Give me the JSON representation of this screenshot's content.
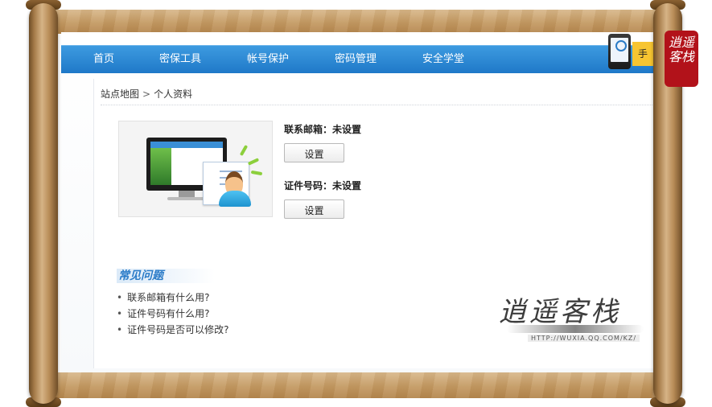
{
  "nav": {
    "items": [
      {
        "label": "首页"
      },
      {
        "label": "密保工具"
      },
      {
        "label": "帐号保护"
      },
      {
        "label": "密码管理"
      },
      {
        "label": "安全学堂"
      }
    ],
    "side_tag": "手"
  },
  "breadcrumb": {
    "root": "站点地图",
    "separator": ">",
    "current": "个人资料"
  },
  "profile": {
    "email_label": "联系邮箱：未设置",
    "email_button": "设置",
    "id_label": "证件号码：未设置",
    "id_button": "设置"
  },
  "faq": {
    "title": "常见问题",
    "items": [
      "联系邮箱有什么用?",
      "证件号码有什么用?",
      "证件号码是否可以修改?"
    ]
  },
  "watermark": {
    "title": "逍遥客栈",
    "url": "HTTP://WUXIA.QQ.COM/KZ/"
  },
  "seal": {
    "text": "逍遥客栈"
  },
  "colors": {
    "nav_blue": "#1f78c8",
    "faq_blue": "#2a7bc8",
    "seal_red": "#b2121a",
    "scroll_wood": "#c49a63"
  }
}
